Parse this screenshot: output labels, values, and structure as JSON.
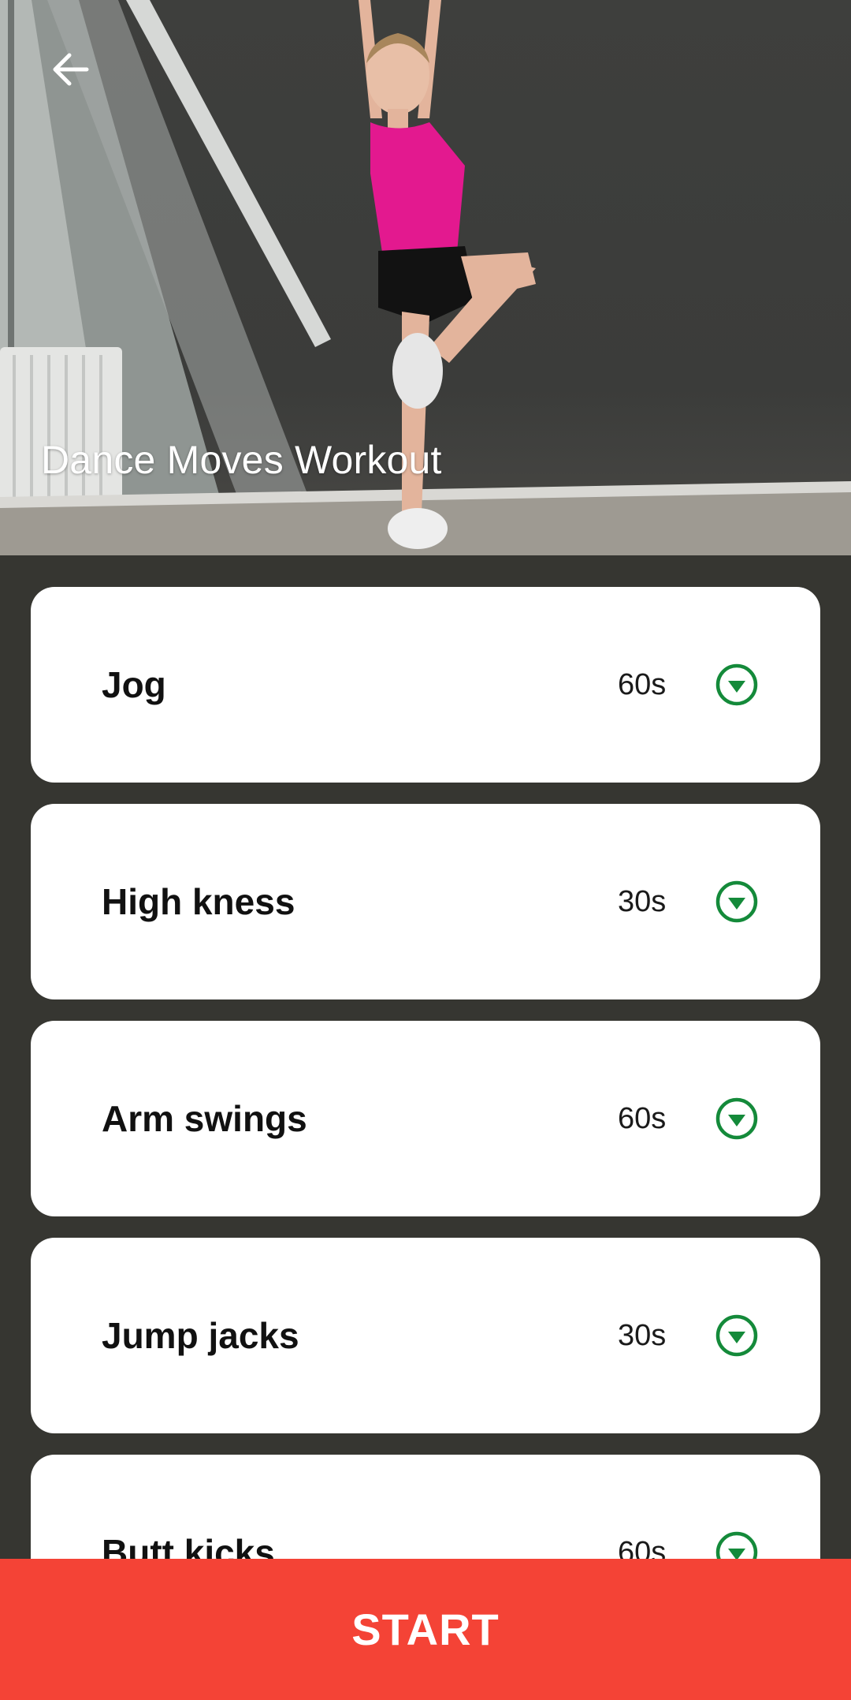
{
  "hero": {
    "title": "Dance Moves Workout",
    "back_icon": "arrow-back-icon"
  },
  "exercises": [
    {
      "name": "Jog",
      "duration": "60s"
    },
    {
      "name": "High kness",
      "duration": "30s"
    },
    {
      "name": "Arm swings",
      "duration": "60s"
    },
    {
      "name": "Jump jacks",
      "duration": "30s"
    },
    {
      "name": "Butt kicks",
      "duration": "60s"
    }
  ],
  "expand_icon": "chevron-down-circle-icon",
  "start_button": {
    "label": "START"
  },
  "colors": {
    "accent": "#f44336",
    "icon_green": "#148a3a",
    "background": "#363631",
    "card": "#ffffff"
  }
}
